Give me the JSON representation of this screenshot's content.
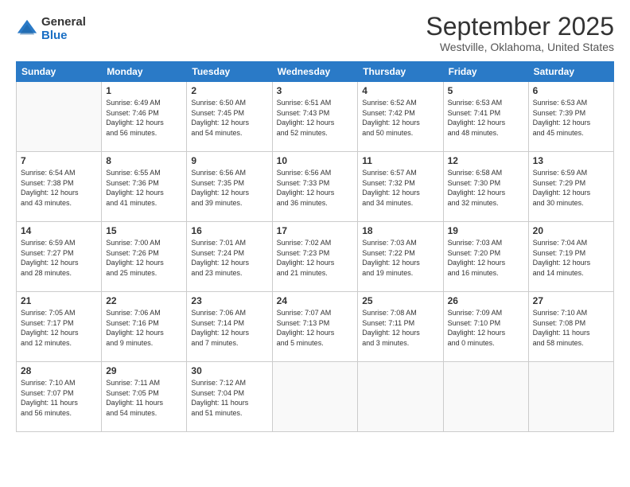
{
  "logo": {
    "general": "General",
    "blue": "Blue"
  },
  "header": {
    "month": "September 2025",
    "location": "Westville, Oklahoma, United States"
  },
  "weekdays": [
    "Sunday",
    "Monday",
    "Tuesday",
    "Wednesday",
    "Thursday",
    "Friday",
    "Saturday"
  ],
  "weeks": [
    [
      {
        "day": "",
        "info": ""
      },
      {
        "day": "1",
        "info": "Sunrise: 6:49 AM\nSunset: 7:46 PM\nDaylight: 12 hours\nand 56 minutes."
      },
      {
        "day": "2",
        "info": "Sunrise: 6:50 AM\nSunset: 7:45 PM\nDaylight: 12 hours\nand 54 minutes."
      },
      {
        "day": "3",
        "info": "Sunrise: 6:51 AM\nSunset: 7:43 PM\nDaylight: 12 hours\nand 52 minutes."
      },
      {
        "day": "4",
        "info": "Sunrise: 6:52 AM\nSunset: 7:42 PM\nDaylight: 12 hours\nand 50 minutes."
      },
      {
        "day": "5",
        "info": "Sunrise: 6:53 AM\nSunset: 7:41 PM\nDaylight: 12 hours\nand 48 minutes."
      },
      {
        "day": "6",
        "info": "Sunrise: 6:53 AM\nSunset: 7:39 PM\nDaylight: 12 hours\nand 45 minutes."
      }
    ],
    [
      {
        "day": "7",
        "info": "Sunrise: 6:54 AM\nSunset: 7:38 PM\nDaylight: 12 hours\nand 43 minutes."
      },
      {
        "day": "8",
        "info": "Sunrise: 6:55 AM\nSunset: 7:36 PM\nDaylight: 12 hours\nand 41 minutes."
      },
      {
        "day": "9",
        "info": "Sunrise: 6:56 AM\nSunset: 7:35 PM\nDaylight: 12 hours\nand 39 minutes."
      },
      {
        "day": "10",
        "info": "Sunrise: 6:56 AM\nSunset: 7:33 PM\nDaylight: 12 hours\nand 36 minutes."
      },
      {
        "day": "11",
        "info": "Sunrise: 6:57 AM\nSunset: 7:32 PM\nDaylight: 12 hours\nand 34 minutes."
      },
      {
        "day": "12",
        "info": "Sunrise: 6:58 AM\nSunset: 7:30 PM\nDaylight: 12 hours\nand 32 minutes."
      },
      {
        "day": "13",
        "info": "Sunrise: 6:59 AM\nSunset: 7:29 PM\nDaylight: 12 hours\nand 30 minutes."
      }
    ],
    [
      {
        "day": "14",
        "info": "Sunrise: 6:59 AM\nSunset: 7:27 PM\nDaylight: 12 hours\nand 28 minutes."
      },
      {
        "day": "15",
        "info": "Sunrise: 7:00 AM\nSunset: 7:26 PM\nDaylight: 12 hours\nand 25 minutes."
      },
      {
        "day": "16",
        "info": "Sunrise: 7:01 AM\nSunset: 7:24 PM\nDaylight: 12 hours\nand 23 minutes."
      },
      {
        "day": "17",
        "info": "Sunrise: 7:02 AM\nSunset: 7:23 PM\nDaylight: 12 hours\nand 21 minutes."
      },
      {
        "day": "18",
        "info": "Sunrise: 7:03 AM\nSunset: 7:22 PM\nDaylight: 12 hours\nand 19 minutes."
      },
      {
        "day": "19",
        "info": "Sunrise: 7:03 AM\nSunset: 7:20 PM\nDaylight: 12 hours\nand 16 minutes."
      },
      {
        "day": "20",
        "info": "Sunrise: 7:04 AM\nSunset: 7:19 PM\nDaylight: 12 hours\nand 14 minutes."
      }
    ],
    [
      {
        "day": "21",
        "info": "Sunrise: 7:05 AM\nSunset: 7:17 PM\nDaylight: 12 hours\nand 12 minutes."
      },
      {
        "day": "22",
        "info": "Sunrise: 7:06 AM\nSunset: 7:16 PM\nDaylight: 12 hours\nand 9 minutes."
      },
      {
        "day": "23",
        "info": "Sunrise: 7:06 AM\nSunset: 7:14 PM\nDaylight: 12 hours\nand 7 minutes."
      },
      {
        "day": "24",
        "info": "Sunrise: 7:07 AM\nSunset: 7:13 PM\nDaylight: 12 hours\nand 5 minutes."
      },
      {
        "day": "25",
        "info": "Sunrise: 7:08 AM\nSunset: 7:11 PM\nDaylight: 12 hours\nand 3 minutes."
      },
      {
        "day": "26",
        "info": "Sunrise: 7:09 AM\nSunset: 7:10 PM\nDaylight: 12 hours\nand 0 minutes."
      },
      {
        "day": "27",
        "info": "Sunrise: 7:10 AM\nSunset: 7:08 PM\nDaylight: 11 hours\nand 58 minutes."
      }
    ],
    [
      {
        "day": "28",
        "info": "Sunrise: 7:10 AM\nSunset: 7:07 PM\nDaylight: 11 hours\nand 56 minutes."
      },
      {
        "day": "29",
        "info": "Sunrise: 7:11 AM\nSunset: 7:05 PM\nDaylight: 11 hours\nand 54 minutes."
      },
      {
        "day": "30",
        "info": "Sunrise: 7:12 AM\nSunset: 7:04 PM\nDaylight: 11 hours\nand 51 minutes."
      },
      {
        "day": "",
        "info": ""
      },
      {
        "day": "",
        "info": ""
      },
      {
        "day": "",
        "info": ""
      },
      {
        "day": "",
        "info": ""
      }
    ]
  ]
}
